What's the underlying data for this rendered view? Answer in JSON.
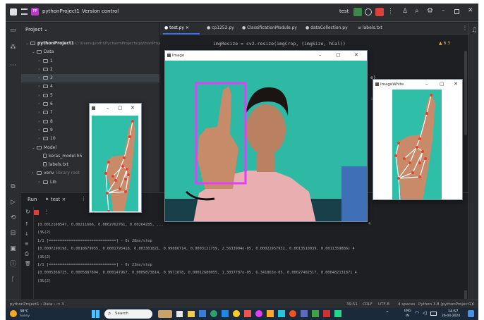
{
  "titlebar": {
    "project_name": "pythonProject1",
    "vcs_label": "Version control",
    "run_config": "test"
  },
  "project_panel": {
    "header": "Project",
    "root_name": "pythonProject1",
    "root_path": "C:\\Users\\jyothi\\PycharmProjects\\pythonProject1",
    "tree": [
      {
        "label": "Data",
        "indent": 1,
        "expanded": true
      },
      {
        "label": "1",
        "indent": 2
      },
      {
        "label": "2",
        "indent": 2
      },
      {
        "label": "3",
        "indent": 2,
        "selected": true
      },
      {
        "label": "4",
        "indent": 2
      },
      {
        "label": "5",
        "indent": 2
      },
      {
        "label": "6",
        "indent": 2
      },
      {
        "label": "7",
        "indent": 2
      },
      {
        "label": "8",
        "indent": 2
      },
      {
        "label": "9",
        "indent": 2
      },
      {
        "label": "10",
        "indent": 2
      },
      {
        "label": "Model",
        "indent": 1,
        "expanded": true
      },
      {
        "label": "keras_model.h5",
        "indent": 2,
        "file": true
      },
      {
        "label": "labels.txt",
        "indent": 2,
        "file": true
      },
      {
        "label": "venv",
        "indent": 1,
        "extra": "library root"
      },
      {
        "label": "Lib",
        "indent": 2
      }
    ]
  },
  "editor": {
    "tabs": [
      "test.py",
      "cp1252.py",
      "ClassificationModule.py",
      "dataCollection.py",
      "labels.txt"
    ],
    "active_tab": "test.py",
    "code_line": "imgResize = cv2.resize(imgCrop, (imgSize, hCal))",
    "inspection": "6  3",
    "side_fragment_1": "e)",
    "side_fragment_2": ":"
  },
  "windows": {
    "image": {
      "title": "Image"
    },
    "image_white": {
      "title": "ImageWhite"
    }
  },
  "run_panel": {
    "tab_run": "Run",
    "config": "test",
    "console_lines": [
      "[0.0012198547, 0.00211666, 0.0002762761, 0.00264285, ...",
      "(3&(2)",
      "1/1 [==============================] - 0s 28ms/step",
      "[0.0007290198, 0.0018679955, 0.0001795418, 0.003301821, 0.99086714, 0.0003121759, 2.5633904e-05, 0.00022957932, 0.0013510039, 0.0011359886] 4",
      "(3&(2)",
      "1/1 [==============================] - 0s 23ms/step",
      "[0.0005368725, 0.0005887894, 0.000147967, 0.0009873814, 0.9971878, 0.00012680055, 1.3037787e-05, 6.341863e-05, 0.00027402517, 0.00048213187] 4",
      "(3&(2)"
    ],
    "trailing_4": "4"
  },
  "statusbar": {
    "breadcrumb": [
      "pythonProject1",
      "Data",
      "3"
    ],
    "position": "39:51",
    "line_ending": "CRLF",
    "encoding": "UTF-8",
    "indent": "4 spaces",
    "interpreter": "Python 3.8 (pythonProject1)"
  },
  "taskbar": {
    "weather_temp": "38°C",
    "weather_desc": "Sunny",
    "search_placeholder": "Search",
    "lang": "ENG",
    "lang_region": "IN",
    "time": "14:57",
    "date": "26-04-2024"
  },
  "colors": {
    "ide_bg": "#1e1f22",
    "panel_bg": "#2b2d30",
    "accent_blue": "#3574f0",
    "teal_bg": "#2fbfa8",
    "bbox_magenta": "#e040fb",
    "landmark_red": "#e8412e"
  }
}
